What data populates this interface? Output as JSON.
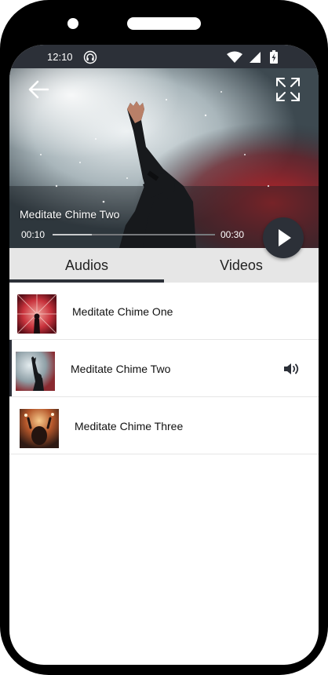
{
  "status_bar": {
    "time": "12:10"
  },
  "player": {
    "title": "Meditate Chime Two",
    "current_time": "00:10",
    "total_time": "00:30",
    "progress": 0.24
  },
  "tabs": [
    {
      "label": "Audios",
      "selected": true
    },
    {
      "label": "Videos",
      "selected": false
    }
  ],
  "tracks": [
    {
      "title": "Meditate Chime One",
      "playing": false
    },
    {
      "title": "Meditate Chime Two",
      "playing": true
    },
    {
      "title": "Meditate Chime Three",
      "playing": false
    }
  ],
  "colors": {
    "accent": "#2c3038",
    "tab_bg": "#e6e6e6",
    "divider": "#e6e6e6"
  }
}
